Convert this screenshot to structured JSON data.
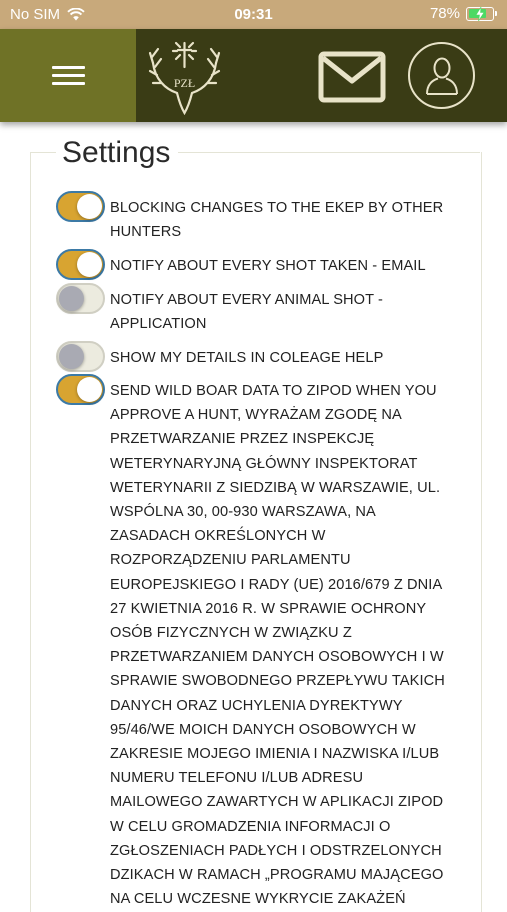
{
  "status_bar": {
    "carrier": "No SIM",
    "time": "09:31",
    "battery": "78%",
    "battery_level": 0.78,
    "wifi_icon": "wifi-icon",
    "battery_icon": "battery-charging-icon"
  },
  "header": {
    "menu_icon": "hamburger-menu-icon",
    "logo_text": "PZŁ",
    "mail_icon": "envelope-icon",
    "profile_icon": "user-profile-icon",
    "colors": {
      "header_bg": "#3a3c15",
      "menu_bg": "#6f7226",
      "status_bg": "#c8a97b",
      "toggle_on": "#d8a431"
    }
  },
  "settings": {
    "title": "Settings",
    "items": [
      {
        "label": "BLOCKING CHANGES TO THE EKEP BY OTHER HUNTERS",
        "enabled": true
      },
      {
        "label": "NOTIFY ABOUT EVERY SHOT TAKEN - EMAIL",
        "enabled": true
      },
      {
        "label": "NOTIFY ABOUT EVERY ANIMAL SHOT - APPLICATION",
        "enabled": false
      },
      {
        "label": "SHOW MY DETAILS IN COLEAGE HELP",
        "enabled": false
      },
      {
        "label": "SEND WILD BOAR DATA TO ZIPOD WHEN YOU APPROVE A HUNT, WYRAŻAM ZGODĘ NA PRZETWARZANIE PRZEZ INSPEKCJĘ WETERYNARYJNĄ GŁÓWNY INSPEKTORAT WETERYNARII Z SIEDZIBĄ W WARSZAWIE, UL. WSPÓLNA 30, 00-930 WARSZAWA, NA ZASADACH OKREŚLONYCH W ROZPORZĄDZENIU PARLAMENTU EUROPEJSKIEGO I RADY (UE) 2016/679 Z DNIA 27 KWIETNIA 2016 R. W SPRAWIE OCHRONY OSÓB FIZYCZNYCH W ZWIĄZKU Z PRZETWARZANIEM DANYCH OSOBOWYCH I W SPRAWIE SWOBODNEGO PRZEPŁYWU TAKICH DANYCH ORAZ UCHYLENIA DYREKTYWY 95/46/WE MOICH DANYCH OSOBOWYCH W ZAKRESIE MOJEGO IMIENIA I NAZWISKA I/LUB NUMERU TELEFONU I/LUB ADRESU MAILOWEGO ZAWARTYCH W APLIKACJI ZIPOD W CELU GROMADZENIA INFORMACJI O ZGŁOSZENIACH PADŁYCH I ODSTRZELONYCH DZIKACH W RAMACH „PROGRAMU MAJĄCEGO NA CELU WCZESNE WYKRYCIE ZAKAŻEŃ",
        "enabled": true
      }
    ]
  }
}
